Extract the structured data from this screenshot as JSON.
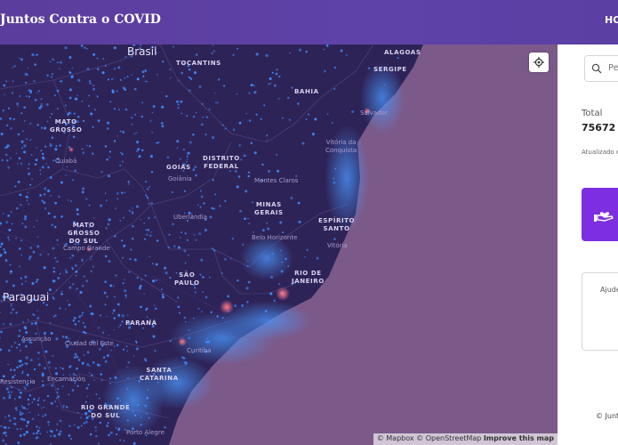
{
  "header": {
    "brand": "Juntos Contra o COVID",
    "nav_home": "HOME"
  },
  "map": {
    "labels": {
      "brasil": "Brasil",
      "tocantins": "TOCANTINS",
      "alagoas": "ALAGOAS",
      "sergipe": "SERGIPE",
      "bahia": "BAHIA",
      "salvador": "Salvador",
      "mato_grosso": "MATO\nGROSSO",
      "cuiaba": "Cuiabá",
      "distrito_federal": "DISTRITO\nFEDERAL",
      "goias": "GOIÁS",
      "goiania": "Goiânia",
      "vitoria_da_conquista": "Vitória da\nConquista",
      "montes_claros": "Montes Claros",
      "minas_gerais": "MINAS\nGERAIS",
      "espirito_santo": "ESPÍRITO\nSANTO",
      "mato_grosso_do_sul": "MATO\nGROSSO\nDO SUL",
      "campo_grande": "Campo Grande",
      "uberlandia": "Uberlândia",
      "belo_horizonte": "Belo Horizonte",
      "vitoria": "Vitória",
      "sao_paulo": "SÃO\nPAULO",
      "rio_de_janeiro": "RIO DE\nJANEIRO",
      "paraguai": "Paraguai",
      "parana": "PARANÁ",
      "assuncao": "Assunção",
      "ciudad_del_este": "Ciudad del Este",
      "curitiba": "Curitiba",
      "santa_catarina": "SANTA\nCATARINA",
      "resistencia": "Resistencia",
      "encarnacion": "Encarnación",
      "rio_grande_do_sul": "RIO GRANDE\nDO SUL",
      "porto_alegre": "Porto Alegre"
    },
    "attribution": {
      "mapbox": "© Mapbox",
      "osm": "© OpenStreetMap",
      "improve": "Improve this map"
    },
    "colors": {
      "land": "#2e2357",
      "ocean": "#7b5a8a",
      "case_dot": "#3d8cff",
      "hotspot": "#e8667a"
    }
  },
  "panel": {
    "search_placeholder": "Pe",
    "total_label": "Total",
    "total_value": "75672",
    "updated_label": "Atualizado e",
    "help_text": "Ajude",
    "copyright": "© Junt"
  },
  "icons": {
    "locate": "crosshair-locate-icon",
    "search": "search-icon",
    "help": "helping-hand-heart-icon"
  }
}
